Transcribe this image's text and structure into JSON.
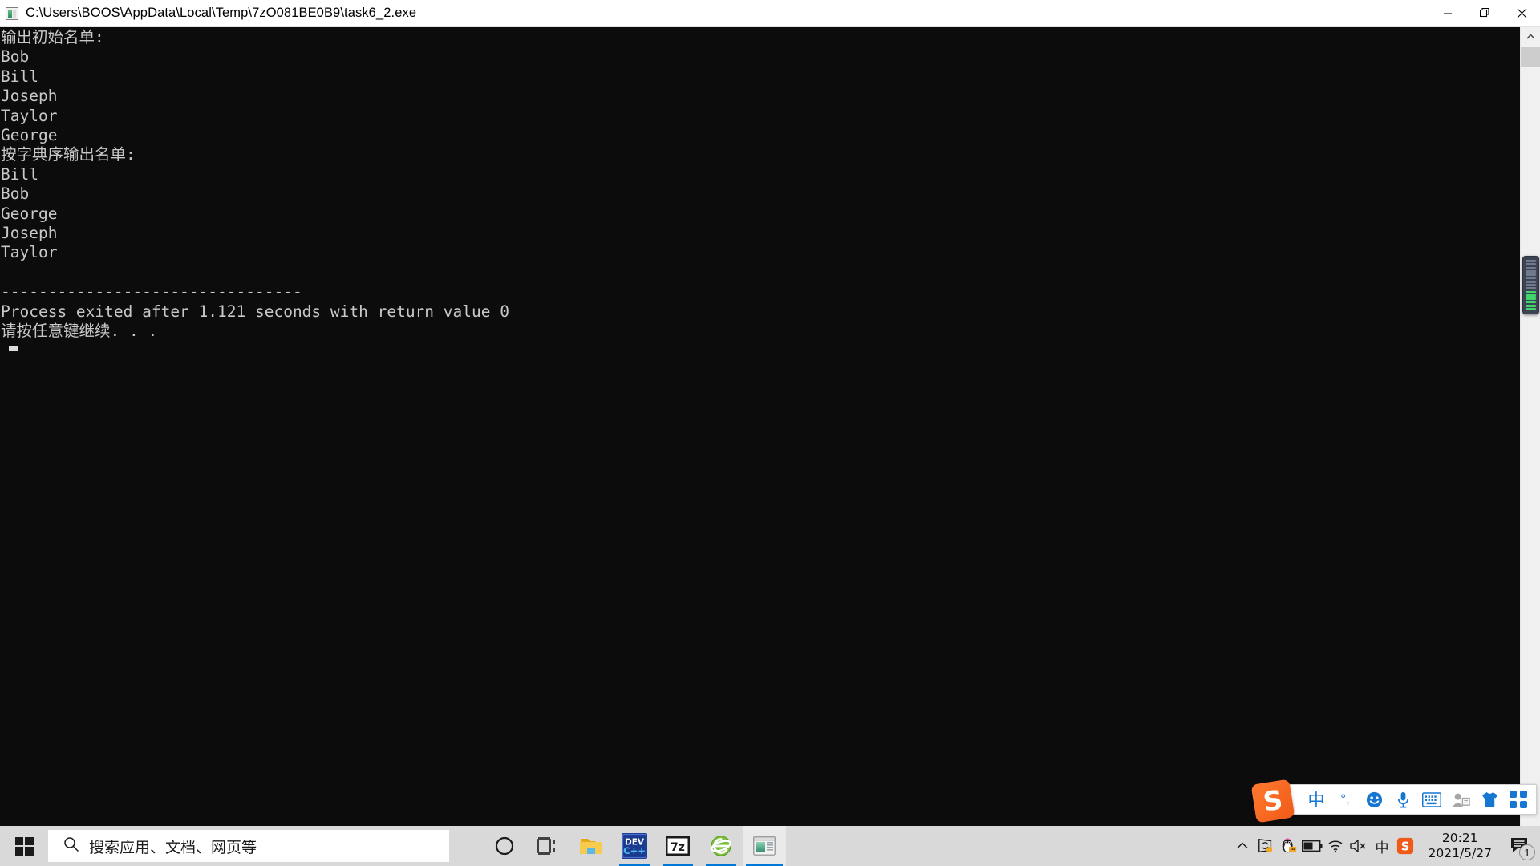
{
  "window": {
    "title": "C:\\Users\\BOOS\\AppData\\Local\\Temp\\7zO081BE0B9\\task6_2.exe",
    "icon": "console-app-icon",
    "controls": {
      "minimize": "minimize-icon",
      "restore": "restore-icon",
      "close": "close-icon"
    }
  },
  "console": {
    "lines": [
      "输出初始名单:",
      "Bob",
      "Bill",
      "Joseph",
      "Taylor",
      "George",
      "按字典序输出名单:",
      "Bill",
      "Bob",
      "George",
      "Joseph",
      "Taylor",
      "",
      "--------------------------------",
      "Process exited after 1.121 seconds with return value 0",
      "请按任意键继续. . . "
    ],
    "text": "输出初始名单:\nBob\nBill\nJoseph\nTaylor\nGeorge\n按字典序输出名单:\nBill\nBob\nGeorge\nJoseph\nTaylor\n\n--------------------------------\nProcess exited after 1.121 seconds with return value 0\n请按任意键继续. . .",
    "foreground_color": "#c8c8c8",
    "background_color": "#0c0c0c",
    "cursor": "block-cursor"
  },
  "scrollbar": {
    "up_arrow": "chevron-up-icon",
    "thumb": "scroll-thumb",
    "meter": {
      "green_segments": 6,
      "gray_segments": 9
    }
  },
  "taskbar": {
    "start": {
      "label": "Start",
      "icon": "windows-logo-icon"
    },
    "search": {
      "placeholder": "搜索应用、文档、网页等",
      "icon": "search-icon"
    },
    "items": [
      {
        "name": "cortana",
        "icon": "cortana-circle-icon",
        "running": false,
        "active": false
      },
      {
        "name": "task-view",
        "icon": "task-view-icon",
        "running": false,
        "active": false
      },
      {
        "name": "file-explorer",
        "icon": "folder-icon",
        "running": false,
        "active": false
      },
      {
        "name": "dev-cpp",
        "icon": "dev-cpp-icon",
        "label": "DEV",
        "sublabel": "C++",
        "running": true,
        "active": false
      },
      {
        "name": "7zip",
        "icon": "sevenzip-icon",
        "label": "7z",
        "running": true,
        "active": false
      },
      {
        "name": "internet-explorer",
        "icon": "internet-explorer-icon",
        "running": true,
        "active": false
      },
      {
        "name": "console-window",
        "icon": "console-app-icon",
        "running": true,
        "active": true
      }
    ],
    "tray": {
      "show_hidden": "chevron-up-icon",
      "icons": [
        {
          "name": "sync-icon"
        },
        {
          "name": "qq-penguin-icon"
        },
        {
          "name": "battery-icon"
        },
        {
          "name": "wifi-icon"
        },
        {
          "name": "speaker-muted-icon"
        },
        {
          "name": "ime-chinese-icon",
          "label": "中"
        },
        {
          "name": "sogou-icon",
          "label": "S"
        }
      ],
      "clock": {
        "time": "20:21",
        "date": "2021/5/27"
      },
      "notifications": {
        "icon": "notification-icon",
        "count": "1"
      }
    }
  },
  "ime_bar": {
    "logo": "sogou-logo-icon",
    "logo_label": "S",
    "items": [
      {
        "name": "ime-mode-chinese",
        "label": "中"
      },
      {
        "name": "ime-punctuation-icon",
        "label": "°,"
      },
      {
        "name": "ime-emoji-icon"
      },
      {
        "name": "ime-voice-icon"
      },
      {
        "name": "ime-keyboard-icon"
      },
      {
        "name": "ime-account-icon"
      },
      {
        "name": "ime-skin-icon"
      },
      {
        "name": "ime-toolbox-icon"
      }
    ]
  },
  "colors": {
    "accent": "#0078d7",
    "taskbar_bg": "#d9d9d9",
    "console_bg": "#0c0c0c",
    "sogou_orange": "#f05a18",
    "ime_blue": "#1677d2"
  }
}
